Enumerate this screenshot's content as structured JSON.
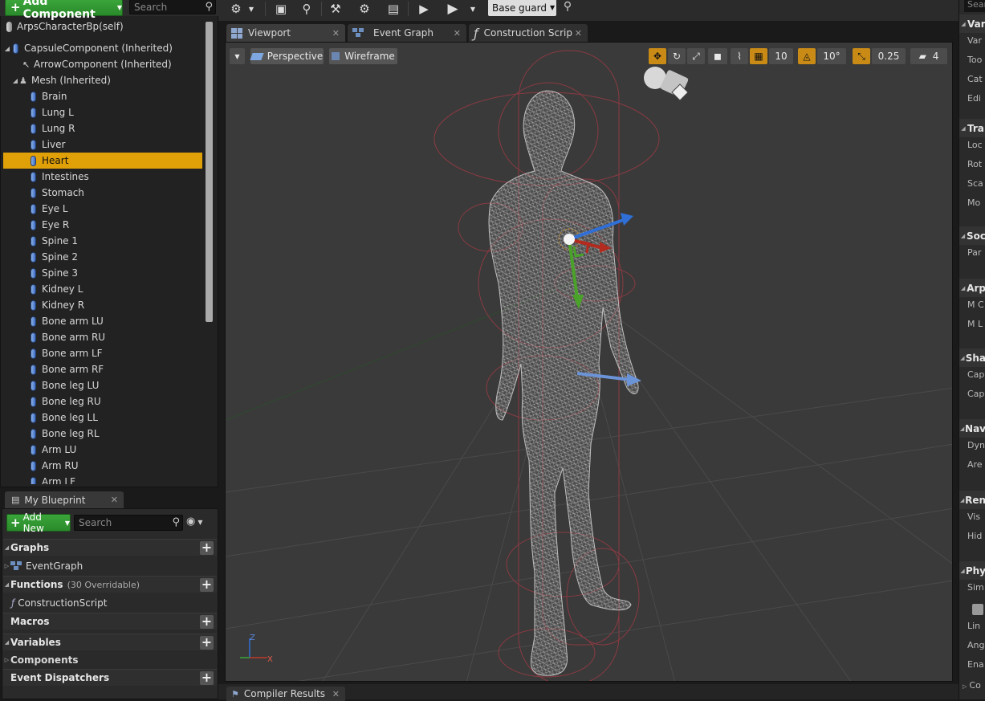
{
  "components_panel": {
    "add_component_label": "Add Component",
    "search_placeholder": "Search",
    "self_label": "ArpsCharacterBp(self)",
    "capsule_label": "CapsuleComponent (Inherited)",
    "arrow_label": "ArrowComponent (Inherited)",
    "mesh_label": "Mesh (Inherited)",
    "items": [
      "Brain",
      "Lung L",
      "Lung R",
      "Liver",
      "Heart",
      "Intestines",
      "Stomach",
      "Eye L",
      "Eye R",
      "Spine 1",
      "Spine 2",
      "Spine 3",
      "Kidney L",
      "Kidney R",
      "Bone arm LU",
      "Bone arm RU",
      "Bone arm LF",
      "Bone arm RF",
      "Bone leg LU",
      "Bone leg RU",
      "Bone leg LL",
      "Bone leg RL",
      "Arm LU",
      "Arm RU",
      "Arm LF"
    ],
    "selected_item": "Heart"
  },
  "my_blueprint": {
    "tab_label": "My Blueprint",
    "add_new_label": "Add New",
    "search_placeholder": "Search",
    "graphs_label": "Graphs",
    "event_graph_label": "EventGraph",
    "functions_label": "Functions",
    "functions_sub": "(30 Overridable)",
    "construction_script_label": "ConstructionScript",
    "macros_label": "Macros",
    "variables_label": "Variables",
    "components_label": "Components",
    "event_dispatchers_label": "Event Dispatchers"
  },
  "toolbar": {
    "debug_filter_value": "Base guard"
  },
  "tabs": {
    "viewport": "Viewport",
    "event_graph": "Event Graph",
    "construction_script": "Construction Scrip",
    "compiler_results": "Compiler Results"
  },
  "viewport": {
    "perspective_label": "Perspective",
    "wireframe_label": "Wireframe",
    "grid_snap_value": "10",
    "rotation_snap_value": "10°",
    "scale_snap_value": "0.25",
    "camera_speed_value": "4",
    "axis_x": "X",
    "axis_z": "Z"
  },
  "details": {
    "search_placeholder": "Sear",
    "sections": [
      {
        "label": "Var",
        "rows": [
          "Var",
          "Too",
          "Cat",
          "Edi"
        ]
      },
      {
        "label": "Tra",
        "rows": [
          "Loc",
          "Rot",
          "Sca",
          "Mo"
        ]
      },
      {
        "label": "Soc",
        "rows": [
          "Par"
        ]
      },
      {
        "label": "Arp",
        "rows": [
          "M C",
          "M L"
        ]
      },
      {
        "label": "Sha",
        "rows": [
          "Cap",
          "Cap"
        ]
      },
      {
        "label": "Nav",
        "rows": [
          "Dyn",
          "Are"
        ]
      },
      {
        "label": "Ren",
        "rows": [
          "Vis",
          "Hid"
        ]
      },
      {
        "label": "Phy",
        "rows": [
          "Sim",
          "",
          "Lin",
          "Ang",
          "Ena"
        ]
      }
    ],
    "footer_label": "Co"
  },
  "colors": {
    "selection": "#e0a008",
    "accent_green": "#2e962e",
    "snap_orange": "#c98b16"
  }
}
